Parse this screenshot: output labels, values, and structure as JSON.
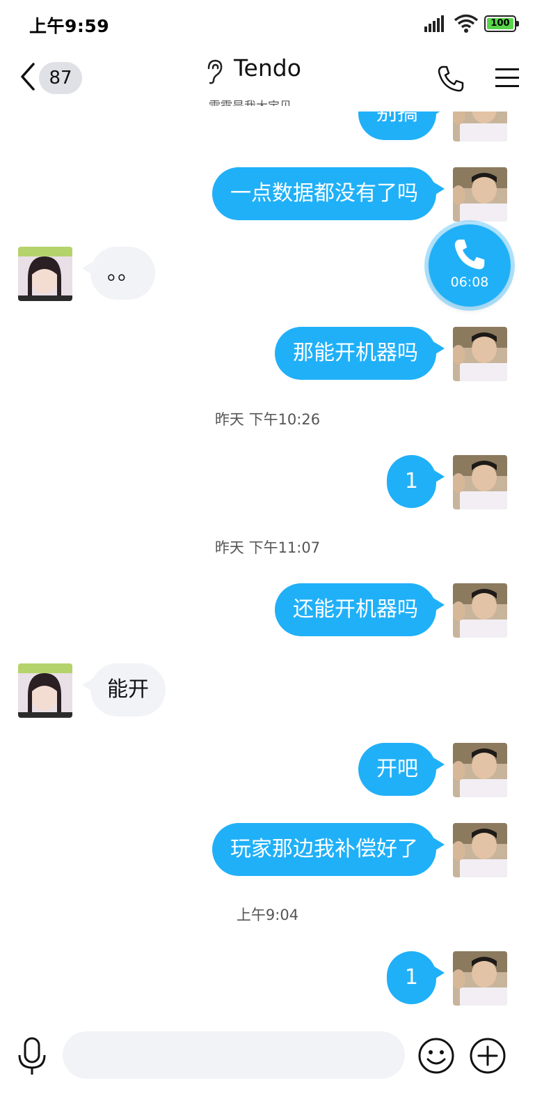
{
  "status_bar": {
    "time": "上午9:59",
    "battery": "100"
  },
  "header": {
    "unread_count": "87",
    "contact_name": "Tendo",
    "subtitle": "雷霆是我大宝贝"
  },
  "call": {
    "duration": "06:08"
  },
  "messages": [
    {
      "side": "out",
      "text": "别搞"
    },
    {
      "side": "out",
      "text": "一点数据都没有了吗"
    },
    {
      "side": "in",
      "text": "。。"
    },
    {
      "side": "out",
      "text": "那能开机器吗"
    },
    {
      "type": "time",
      "text": "昨天 下午10:26"
    },
    {
      "side": "out",
      "text": "1"
    },
    {
      "type": "time",
      "text": "昨天 下午11:07"
    },
    {
      "side": "out",
      "text": "还能开机器吗"
    },
    {
      "side": "in",
      "text": "能开"
    },
    {
      "side": "out",
      "text": "开吧"
    },
    {
      "side": "out",
      "text": "玩家那边我补偿好了"
    },
    {
      "type": "time",
      "text": "上午9:04"
    },
    {
      "side": "out",
      "text": "1"
    }
  ],
  "input": {
    "value": "",
    "placeholder": ""
  },
  "colors": {
    "accent": "#20b0f8",
    "incoming_bubble": "#f2f3f7",
    "battery": "#58d44a"
  }
}
